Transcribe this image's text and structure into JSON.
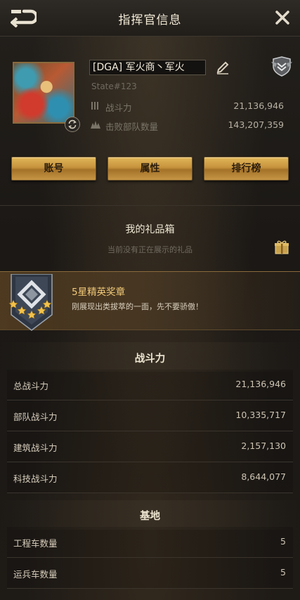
{
  "header": {
    "title": "指挥官信息"
  },
  "profile": {
    "name": "[DGA] 军火商丶军火",
    "state": "State#123",
    "power_label": "战斗力",
    "power_value": "21,136,946",
    "kills_label": "击败部队数量",
    "kills_value": "143,207,359"
  },
  "buttons": {
    "account": "账号",
    "attributes": "属性",
    "leaderboard": "排行榜"
  },
  "gift": {
    "title": "我的礼品箱",
    "subtitle": "当前没有正在展示的礼品"
  },
  "medal": {
    "title": "5星精英奖章",
    "description": "刚展现出类拔萃的一面，先不要骄傲！"
  },
  "power_section": {
    "title": "战斗力",
    "rows": [
      {
        "label": "总战斗力",
        "value": "21,136,946"
      },
      {
        "label": "部队战斗力",
        "value": "10,335,717"
      },
      {
        "label": "建筑战斗力",
        "value": "2,157,130"
      },
      {
        "label": "科技战斗力",
        "value": "8,644,077"
      }
    ]
  },
  "base_section": {
    "title": "基地",
    "rows": [
      {
        "label": "工程车数量",
        "value": "5"
      },
      {
        "label": "运兵车数量",
        "value": "5"
      }
    ]
  },
  "colors": {
    "gold_button": "#c5923c",
    "medal_title": "#f1c978",
    "background": "#1c1916"
  }
}
